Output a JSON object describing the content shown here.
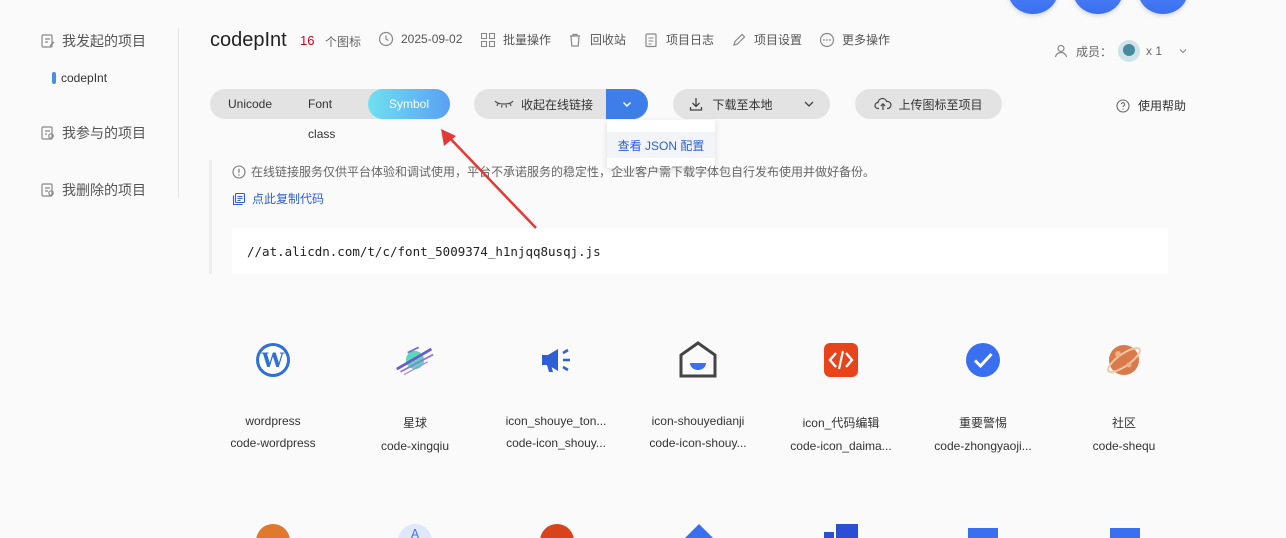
{
  "sidebar": {
    "items": [
      {
        "label": "我发起的项目"
      },
      {
        "label": "我参与的项目"
      },
      {
        "label": "我删除的项目"
      }
    ],
    "sub_item": {
      "label": "codepInt"
    }
  },
  "header": {
    "title": "codepInt",
    "icon_count": "16",
    "icon_count_label": "个图标",
    "date": "2025-09-02",
    "actions": [
      {
        "label": "批量操作",
        "icon": "batch-icon"
      },
      {
        "label": "回收站",
        "icon": "trash-icon"
      },
      {
        "label": "项目日志",
        "icon": "log-icon"
      },
      {
        "label": "项目设置",
        "icon": "settings-icon"
      },
      {
        "label": "更多操作",
        "icon": "more-icon"
      }
    ],
    "members_label": "成员：",
    "members_count": "x 1"
  },
  "toolbar": {
    "tabs": [
      {
        "label": "Unicode"
      },
      {
        "label": "Font class"
      },
      {
        "label": "Symbol",
        "active": true
      }
    ],
    "collect_label": "收起在线链接",
    "download_label": "下载至本地",
    "upload_label": "上传图标至项目",
    "help_label": "使用帮助",
    "dropdown_item": "查看 JSON 配置"
  },
  "info": {
    "notice": "在线链接服务仅供平台体验和调试使用，平台不承诺服务的稳定性，企业客户需下载字体包自行发布使用并做好备份。",
    "copy_label": "点此复制代码",
    "code": "//at.alicdn.com/t/c/font_5009374_h1njqq8usqj.js"
  },
  "icons": [
    {
      "name": "wordpress",
      "code": "code-wordpress",
      "icon": "wordpress-icon"
    },
    {
      "name": "星球",
      "code": "code-xingqiu",
      "icon": "planet-icon"
    },
    {
      "name": "icon_shouye_ton...",
      "code": "code-icon_shouy...",
      "icon": "megaphone-icon"
    },
    {
      "name": "icon-shouyedianji",
      "code": "code-icon-shouy...",
      "icon": "home-icon"
    },
    {
      "name": "icon_代码编辑",
      "code": "code-icon_daima...",
      "icon": "code-edit-icon"
    },
    {
      "name": "重要警惕",
      "code": "code-zhongyaoji...",
      "icon": "check-badge-icon"
    },
    {
      "name": "社区",
      "code": "code-shequ",
      "icon": "community-planet-icon"
    }
  ],
  "colors": {
    "accent": "#3d7eea",
    "link": "#2b5fd9",
    "count": "#d0021b",
    "arrow": "#e53935"
  }
}
